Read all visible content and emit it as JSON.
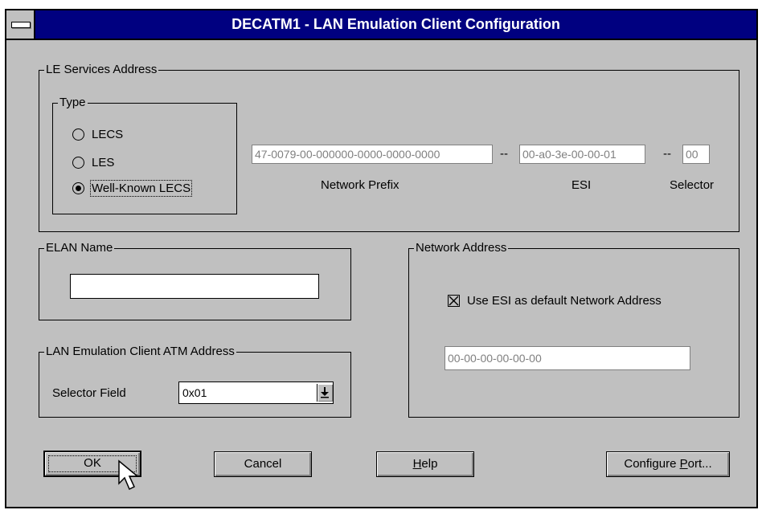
{
  "window": {
    "title": "DECATM1 - LAN Emulation Client Configuration"
  },
  "le_services": {
    "group_label": "LE Services Address",
    "type_group_label": "Type",
    "options": [
      {
        "label": "LECS",
        "selected": false
      },
      {
        "label": "LES",
        "selected": false
      },
      {
        "label": "Well-Known LECS",
        "selected": true
      }
    ],
    "network_prefix": {
      "value": "47-0079-00-000000-0000-0000-0000",
      "label": "Network Prefix"
    },
    "sep1": "--",
    "esi": {
      "value": "00-a0-3e-00-00-01",
      "label": "ESI"
    },
    "sep2": "--",
    "selector": {
      "value": "00",
      "label": "Selector"
    }
  },
  "elan": {
    "group_label": "ELAN Name",
    "value": ""
  },
  "lec_atm": {
    "group_label": "LAN Emulation Client ATM Address",
    "selector_label": "Selector Field",
    "selector_value": "0x01"
  },
  "network_address": {
    "group_label": "Network Address",
    "checkbox_label": "Use ESI as default Network Address",
    "checkbox_checked": true,
    "value": "00-00-00-00-00-00"
  },
  "buttons": {
    "ok": "OK",
    "cancel": "Cancel",
    "help_mnemonic": "H",
    "help_rest": "elp",
    "configure_port_prefix": "Configure ",
    "configure_port_mnemonic": "P",
    "configure_port_suffix": "ort..."
  },
  "colors": {
    "title_bar": "#000080",
    "dialog_face": "#c0c0c0"
  }
}
